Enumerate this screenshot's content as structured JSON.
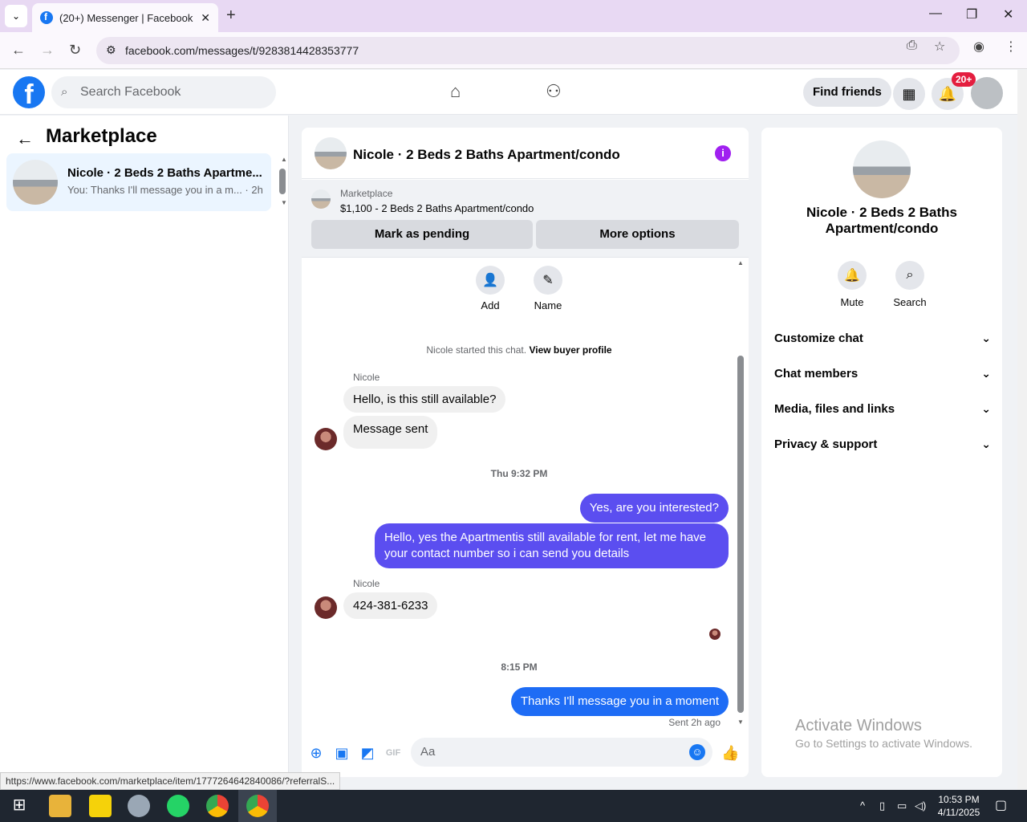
{
  "browser": {
    "tab_title": "(20+) Messenger | Facebook",
    "url": "facebook.com/messages/t/9283814428353777",
    "status_url": "https://www.facebook.com/marketplace/item/1777264642840086/?referralS..."
  },
  "header": {
    "search_placeholder": "Search Facebook",
    "find_friends": "Find friends",
    "notif_badge": "20+"
  },
  "left": {
    "title": "Marketplace",
    "conversations": [
      {
        "name": "Nicole · 2 Beds 2 Baths Apartme...",
        "preview": "You: Thanks I'll message you in a m... · 2h"
      }
    ]
  },
  "chat": {
    "title": "Nicole · 2 Beds 2 Baths Apartment/condo",
    "marketplace_label": "Marketplace",
    "listing": "$1,100 - 2 Beds 2 Baths Apartment/condo",
    "btn_pending": "Mark as pending",
    "btn_more": "More options",
    "action_add": "Add",
    "action_name": "Name",
    "started_text": "Nicole started this chat.",
    "view_buyer": "View buyer profile",
    "sender_name": "Nicole",
    "msg1": "Hello, is this still available?",
    "msg2": "Message sent",
    "ts1": "Thu 9:32 PM",
    "msg3": "Yes, are you interested?",
    "msg4": "Hello, yes the Apartmentis still available for rent, let me have your contact number so i can send you  details",
    "msg5": "424-381-6233",
    "ts2": "8:15 PM",
    "msg6": "Thanks I'll message you in a moment",
    "sent_ago": "Sent 2h ago",
    "composer_placeholder": "Aa"
  },
  "right": {
    "name": "Nicole · 2 Beds 2 Baths Apartment/condo",
    "mute": "Mute",
    "search": "Search",
    "rows": [
      "Customize chat",
      "Chat members",
      "Media, files and links",
      "Privacy & support"
    ],
    "activate_title": "Activate Windows",
    "activate_sub": "Go to Settings to activate Windows."
  },
  "taskbar": {
    "time": "10:53 PM",
    "date": "4/11/2025"
  }
}
